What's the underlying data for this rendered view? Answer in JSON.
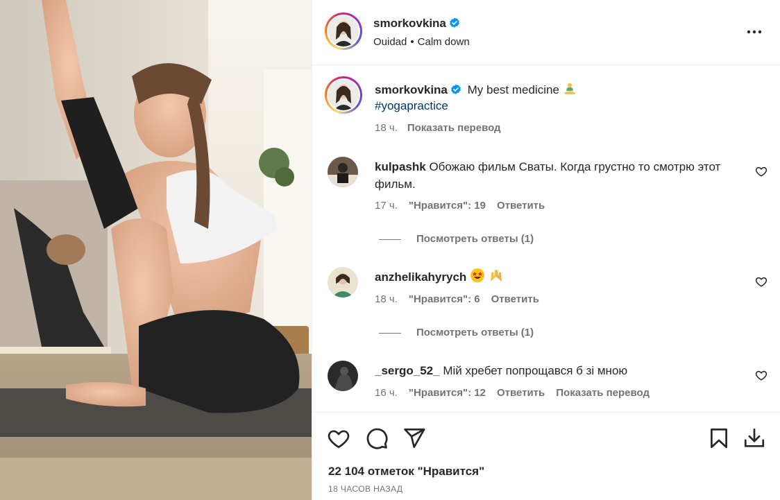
{
  "post": {
    "username": "smorkovkina",
    "audio_artist": "Ouidad",
    "separator": "•",
    "audio_track": "Calm down",
    "caption_username": "smorkovkina",
    "caption_text": "My best medicine",
    "caption_emoji_icon": "person-in-lotus-position-icon",
    "hashtag": "#yogapractice",
    "caption_time": "18 ч.",
    "translate_label": "Показать перевод"
  },
  "comments": [
    {
      "username": "kulpashk",
      "text": "Обожаю фильм Сваты. Когда грустно то смотрю этот фильм.",
      "time": "17 ч.",
      "likes": "\"Нравится\": 19",
      "reply": "Ответить",
      "replies": "Посмотреть ответы (1)"
    },
    {
      "username": "anzhelikahyrych",
      "text": "",
      "emoji_icons": [
        "star-struck-face-icon",
        "raised-hands-icon"
      ],
      "time": "18 ч.",
      "likes": "\"Нравится\": 6",
      "reply": "Ответить",
      "replies": "Посмотреть ответы (1)"
    },
    {
      "username": "_sergo_52_",
      "text": "Мій хребет попрощався б зі мною",
      "time": "16 ч.",
      "likes": "\"Нравится\": 12",
      "reply": "Ответить",
      "translate": "Показать перевод"
    }
  ],
  "footer": {
    "likes_count": "22 104 отметок \"Нравится\"",
    "posted_ago": "18 часов назад"
  },
  "colors": {
    "verified": "#0095f6",
    "hashtag": "#00376b",
    "muted": "#737373",
    "text": "#262626"
  }
}
